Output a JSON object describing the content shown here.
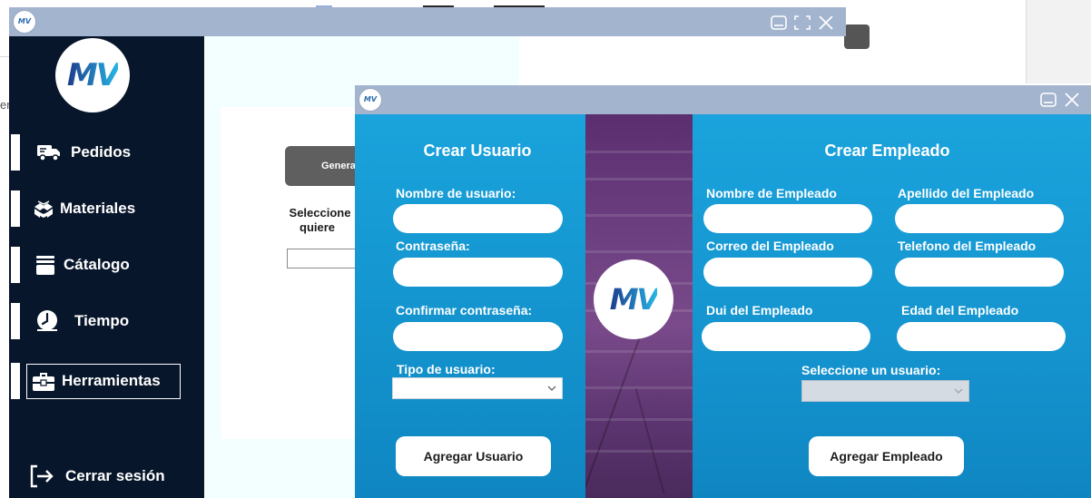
{
  "background_window": {
    "logo_text": "MV",
    "peek_text": "er",
    "sidebar": {
      "logo_text": "MV",
      "items": [
        {
          "label": "Pedidos",
          "icon": "truck-icon"
        },
        {
          "label": "Materiales",
          "icon": "boxes-icon"
        },
        {
          "label": "Cátalogo",
          "icon": "catalog-icon"
        },
        {
          "label": "Tiempo",
          "icon": "clock-icon"
        },
        {
          "label": "Herramientas",
          "icon": "toolbox-icon"
        }
      ],
      "logout_label": "Cerrar sesión"
    },
    "main": {
      "generate_button_label": "Genera",
      "prompt_line1": "Seleccione",
      "prompt_line2": "quiere"
    }
  },
  "dialog": {
    "logo_text": "MV",
    "center_logo_text": "MV",
    "user_form": {
      "title": "Crear Usuario",
      "username_label": "Nombre de usuario:",
      "password_label": "Contraseña:",
      "confirm_password_label": "Confirmar contraseña:",
      "user_type_label": "Tipo de usuario:",
      "user_type_value": "",
      "submit_label": "Agregar Usuario"
    },
    "employee_form": {
      "title": "Crear Empleado",
      "first_name_label": "Nombre de Empleado",
      "last_name_label": "Apellido del Empleado",
      "email_label": "Correo del Empleado",
      "phone_label": "Telefono del Empleado",
      "dui_label": "Dui del Empleado",
      "age_label": "Edad del Empleado",
      "select_user_label": "Seleccione un usuario:",
      "select_user_value": "",
      "submit_label": "Agregar Empleado"
    }
  },
  "colors": {
    "titlebar": "#a3b4cf",
    "sidebar": "#08162b",
    "panel_blue": "#1aa3dc",
    "panel_purple": "#6b3f80"
  }
}
